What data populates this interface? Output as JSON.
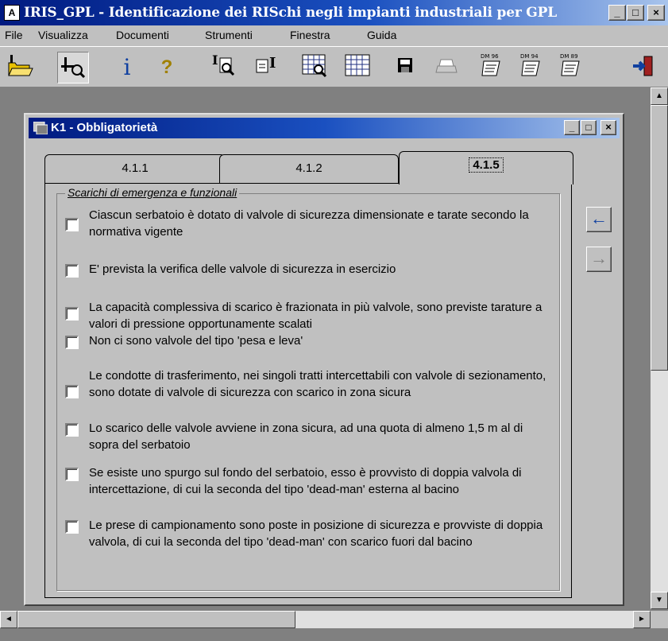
{
  "app": {
    "title": "IRIS_GPL - Identificazione dei RISchi negli impianti industriali  per GPL",
    "icon_label": "A"
  },
  "window_controls": {
    "minimize": "_",
    "maximize": "□",
    "close": "×"
  },
  "menu": [
    "File",
    "Visualizza",
    "Documenti",
    "Strumenti",
    "Finestra",
    "Guida"
  ],
  "toolbar": {
    "icons": [
      "open-folder-icon",
      "find-icon",
      "info-icon",
      "help-icon",
      "text-search-icon",
      "text-insert-icon",
      "grid-search-icon",
      "grid-icon",
      "save-icon",
      "print-icon",
      "dm96-icon",
      "dm94-icon",
      "dm89-icon",
      "exit-icon"
    ],
    "info_glyph": "i",
    "help_glyph": "?",
    "dm_labels": [
      "DM 96",
      "DM 94",
      "DM 89"
    ]
  },
  "child_window": {
    "title": "K1 - Obbligatorietà",
    "tabs": [
      "4.1.1",
      "4.1.2",
      "4.1.5"
    ],
    "active_tab": 2,
    "group_title": "Scarichi di emergenza e funzionali",
    "items": [
      {
        "text": "Ciascun serbatoio è dotato di valvole di sicurezza dimensionate e tarate secondo la normativa vigente",
        "checked": false
      },
      {
        "text": "E' prevista la verifica delle valvole di sicurezza in esercizio",
        "checked": false
      },
      {
        "text": "La capacità complessiva di scarico è frazionata in più valvole, sono previste tarature a valori di pressione opportunamente scalati",
        "checked": false
      },
      {
        "text": "Non ci sono valvole del tipo 'pesa e leva'",
        "checked": false
      },
      {
        "text": "Le condotte di trasferimento, nei singoli tratti intercettabili con valvole di sezionamento, sono dotate di valvole di sicurezza con scarico in zona sicura",
        "checked": false
      },
      {
        "text": "Lo scarico delle valvole avviene in zona sicura, ad una quota di almeno 1,5 m al di sopra del serbatoio",
        "checked": false
      },
      {
        "text": "Se esiste uno spurgo sul fondo del serbatoio, esso è provvisto di doppia valvola di intercettazione, di cui la seconda del tipo 'dead-man' esterna al bacino",
        "checked": false
      },
      {
        "text": "Le prese di campionamento sono poste in posizione di sicurezza e provviste di doppia valvola, di cui la seconda del tipo 'dead-man' con scarico fuori dal bacino",
        "checked": false
      }
    ],
    "nav": {
      "prev": "←",
      "next": "→"
    }
  },
  "scrollbars": {
    "up": "▲",
    "down": "▼",
    "left": "◄",
    "right": "►"
  },
  "colors": {
    "title_active": "#001a80",
    "face": "#c0c0c0",
    "workspace": "#808080",
    "nav_arrow_active": "#1040a0"
  }
}
